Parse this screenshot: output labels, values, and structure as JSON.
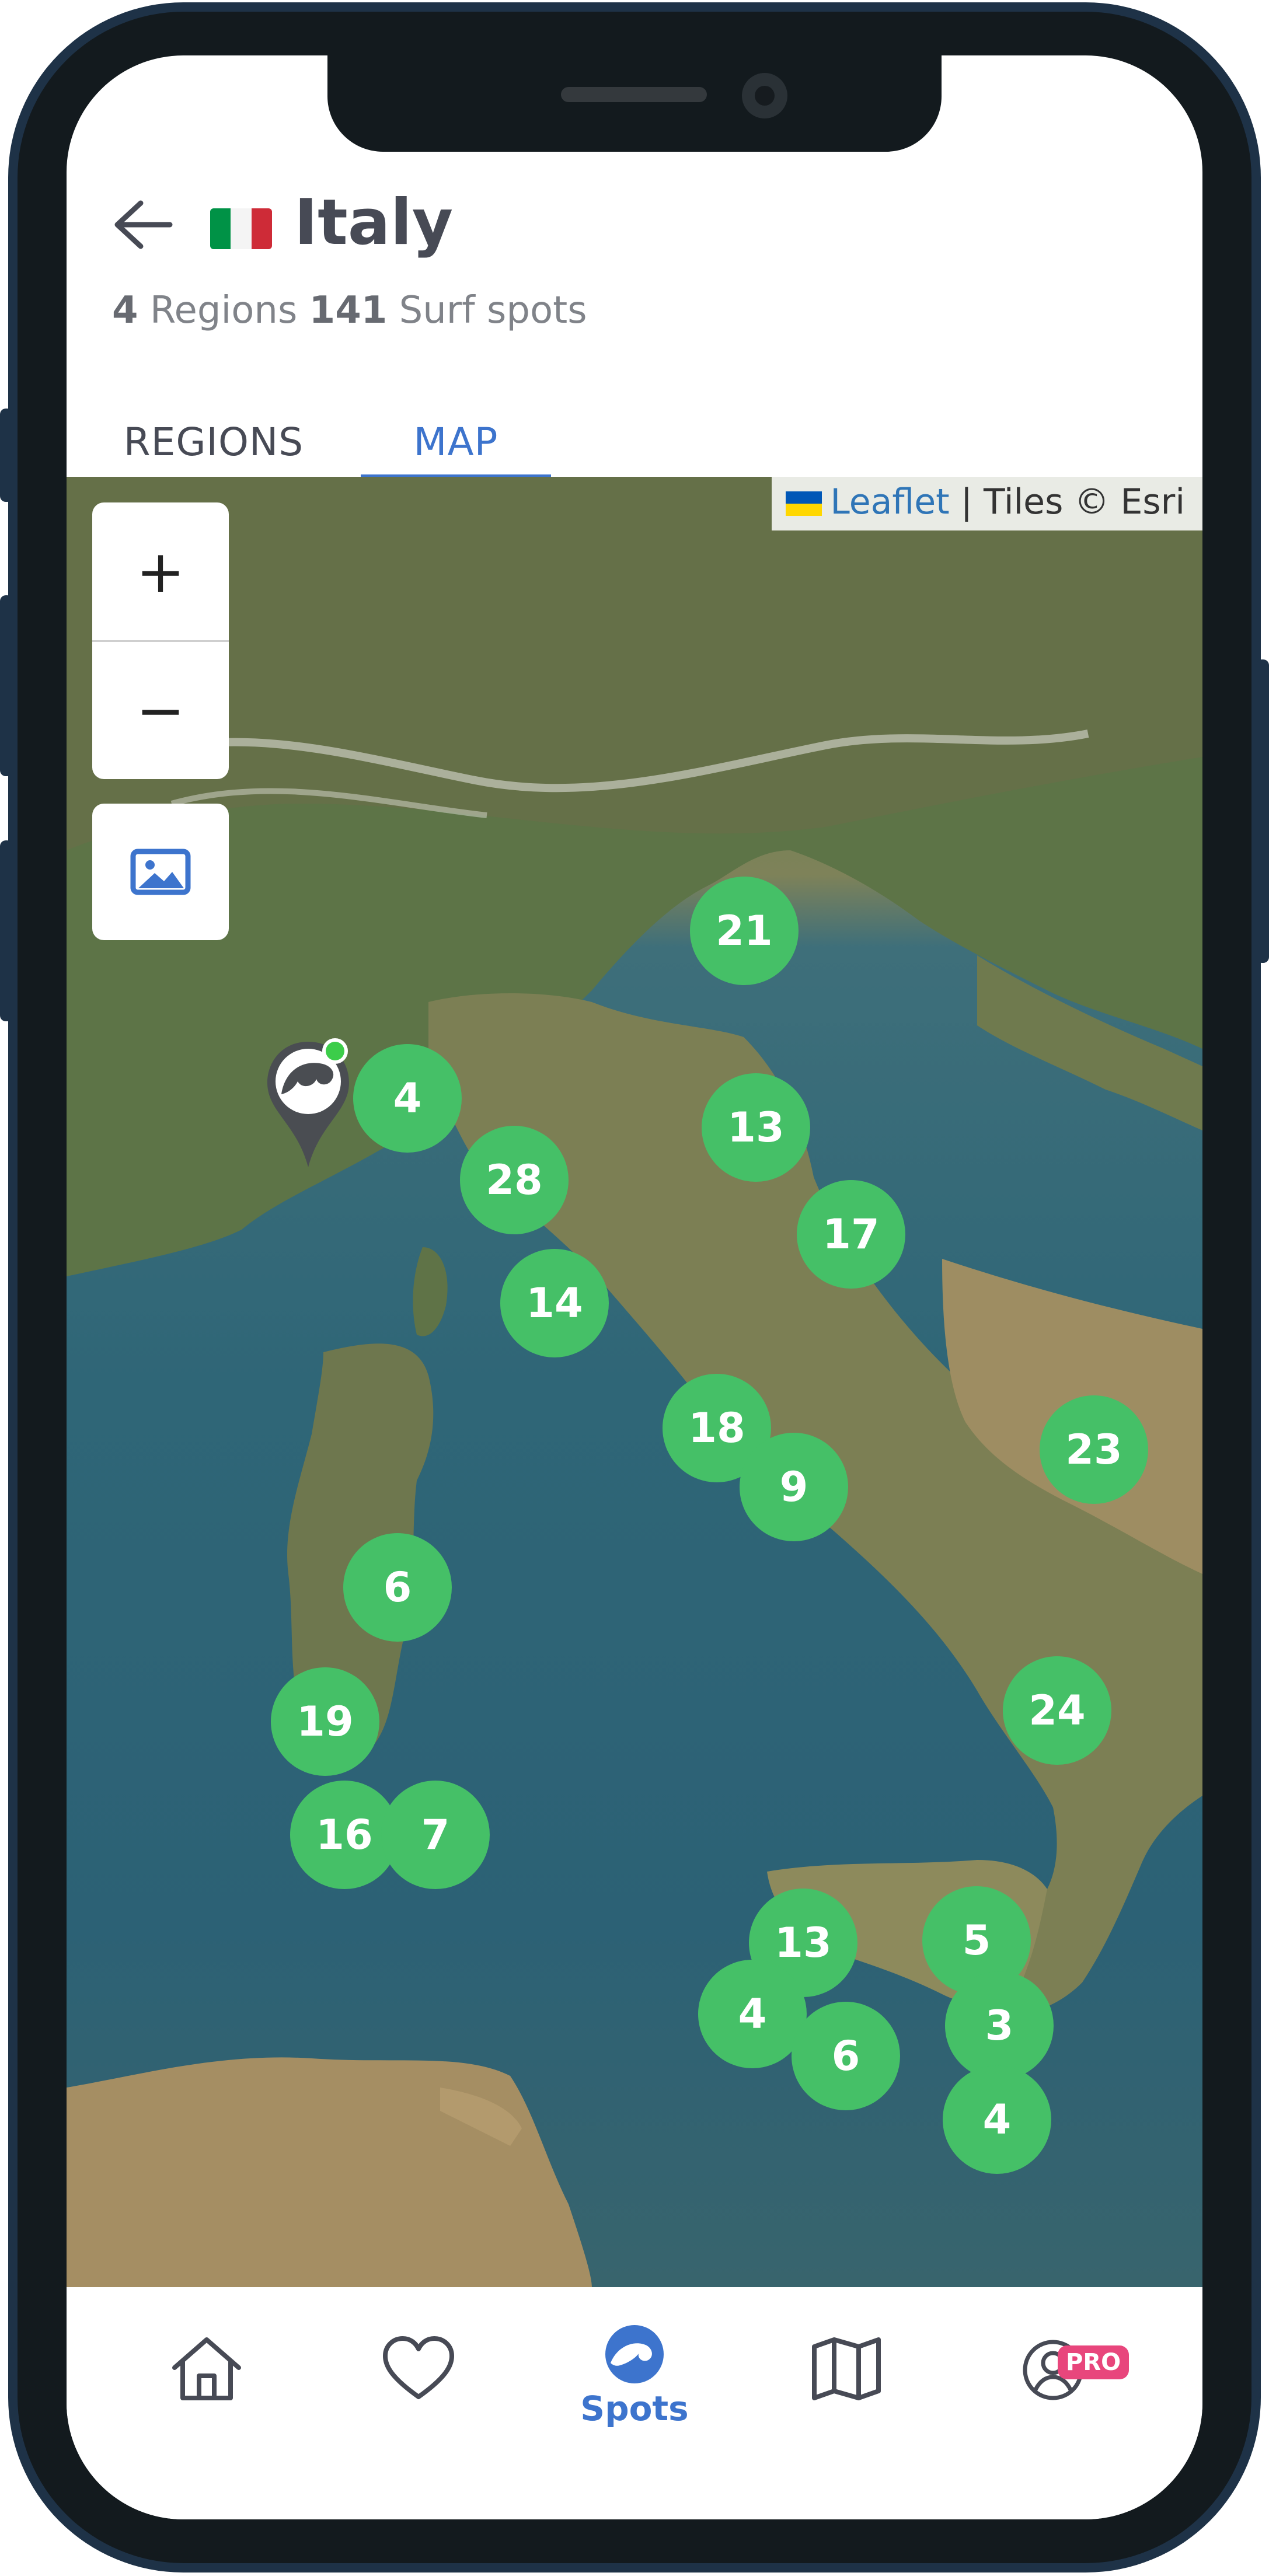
{
  "header": {
    "title": "Italy",
    "region_count": "4",
    "regions_label": "Regions",
    "spot_count": "141",
    "spots_label": "Surf spots",
    "flag_colors": [
      "#009246",
      "#ffffff",
      "#ce2b37"
    ]
  },
  "tabs": [
    {
      "label": "REGIONS",
      "active": false
    },
    {
      "label": "MAP",
      "active": true
    }
  ],
  "map": {
    "attribution_link": "Leaflet",
    "attribution_text": " | Tiles © Esri",
    "zoom_in_label": "+",
    "zoom_out_label": "−",
    "clusters": [
      {
        "count": "21"
      },
      {
        "count": "4"
      },
      {
        "count": "13"
      },
      {
        "count": "28"
      },
      {
        "count": "17"
      },
      {
        "count": "14"
      },
      {
        "count": "18"
      },
      {
        "count": "9"
      },
      {
        "count": "23"
      },
      {
        "count": "6"
      },
      {
        "count": "19"
      },
      {
        "count": "24"
      },
      {
        "count": "16"
      },
      {
        "count": "7"
      },
      {
        "count": "13"
      },
      {
        "count": "5"
      },
      {
        "count": "4"
      },
      {
        "count": "3"
      },
      {
        "count": "6"
      },
      {
        "count": "4"
      }
    ]
  },
  "bottom_nav": {
    "items": [
      {
        "icon": "home-icon",
        "label": ""
      },
      {
        "icon": "heart-icon",
        "label": ""
      },
      {
        "icon": "wave-icon",
        "label": "Spots",
        "active": true
      },
      {
        "icon": "map-icon",
        "label": ""
      },
      {
        "icon": "profile-icon",
        "label": ""
      }
    ],
    "pro_badge": "PRO"
  },
  "colors": {
    "accent": "#3d74cd",
    "cluster": "#45c067",
    "pro": "#e8467c",
    "title": "#474a55"
  }
}
